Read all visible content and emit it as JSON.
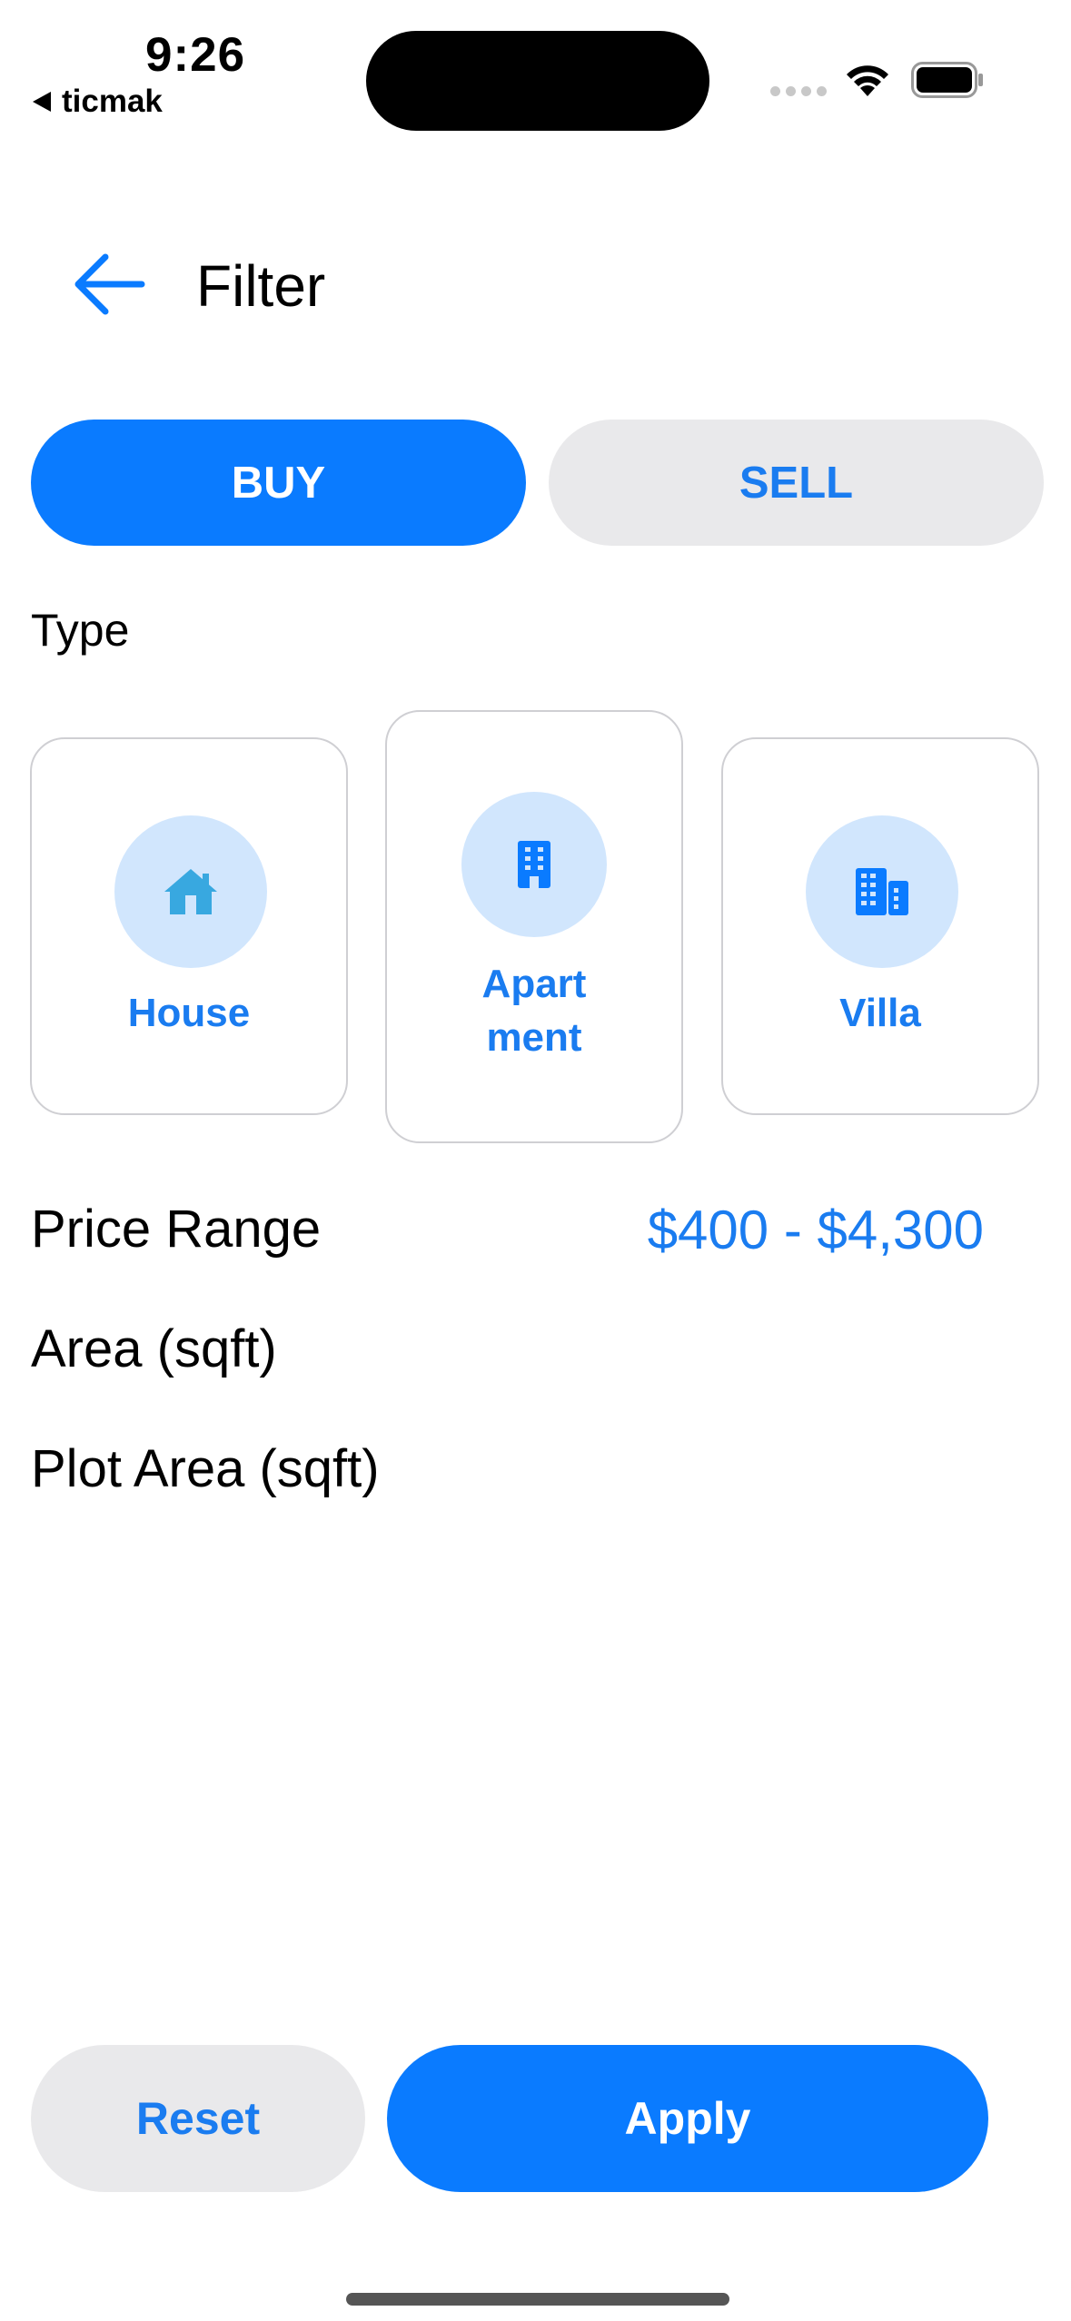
{
  "status_bar": {
    "time": "9:26",
    "back_app": "ticmak"
  },
  "header": {
    "title": "Filter"
  },
  "segments": {
    "buy": "BUY",
    "sell": "SELL",
    "selected": "BUY"
  },
  "type_section": {
    "label": "Type",
    "cards": [
      {
        "label": "House",
        "icon": "house-icon"
      },
      {
        "label": "Apart\nment",
        "icon": "apartment-building-icon"
      },
      {
        "label": "Villa",
        "icon": "villa-buildings-icon"
      }
    ]
  },
  "filters": {
    "price_range_label": "Price Range",
    "price_range_value": "$400 - $4,300",
    "area_label": "Area (sqft)",
    "plot_area_label": "Plot Area (sqft)"
  },
  "actions": {
    "reset": "Reset",
    "apply": "Apply"
  },
  "colors": {
    "accent": "#0a7bff",
    "accent_text": "#1a7cf0",
    "icon_bg": "#d1e6fd",
    "secondary_bg": "#e9e9eb"
  }
}
